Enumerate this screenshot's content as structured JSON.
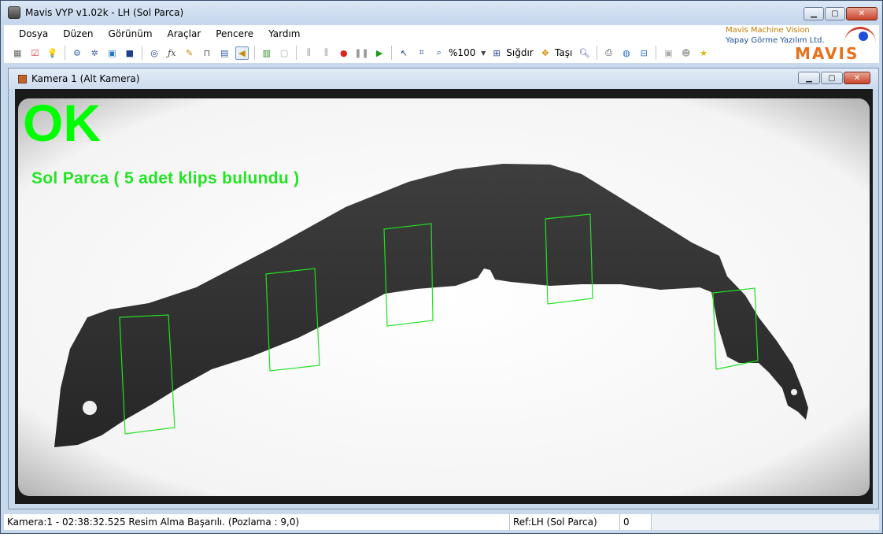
{
  "window": {
    "title": "Mavis VYP v1.02k - LH (Sol Parca)",
    "buttons": {
      "minimize": "▁",
      "maximize": "▢",
      "close": "✕"
    }
  },
  "menu": {
    "items": [
      "Dosya",
      "Düzen",
      "Görünüm",
      "Araçlar",
      "Pencere",
      "Yardım"
    ]
  },
  "toolbar": {
    "zoom_label": "%100",
    "fit_label": "Sığdır",
    "move_label": "Taşı",
    "icons": [
      "grid-icon",
      "checklist-icon",
      "bulb-icon",
      "gear-icon",
      "gears-icon",
      "image-icon",
      "save-icon",
      "zoom-region-icon",
      "function-icon",
      "brush-icon",
      "caliper-icon",
      "calculator-icon",
      "speaker-icon",
      "book-icon",
      "blank-doc-icon",
      "align-left-icon",
      "align-center-icon",
      "record-icon",
      "pause-icon",
      "play-icon",
      "pointer-icon",
      "crop-icon",
      "zoom-page-icon",
      "fit-icon",
      "move-icon",
      "search-icon",
      "print-icon",
      "globe-icon",
      "network-icon",
      "picture-dropdown-icon",
      "users-icon",
      "star-icon"
    ]
  },
  "brand": {
    "line1": "Mavis Machine Vision",
    "line2": "Yapay Görme Yazılım Ltd.",
    "logo": "MAVIS"
  },
  "camera_window": {
    "title": "Kamera 1 (Alt Kamera)",
    "status_word": "OK",
    "result_message": "Sol Parca ( 5 adet klips bulundu )",
    "status_color": "#00ff00",
    "detections": 5
  },
  "statusbar": {
    "camera_info": "Kamera:1 - 02:38:32.525 Resim Alma Başarılı. (Pozlama : 9,0)",
    "ref": "Ref:LH (Sol Parca)",
    "count": "0"
  },
  "colors": {
    "accent": "#c9d9ec",
    "ok_green": "#00ff00",
    "detection_box": "#22e022"
  }
}
